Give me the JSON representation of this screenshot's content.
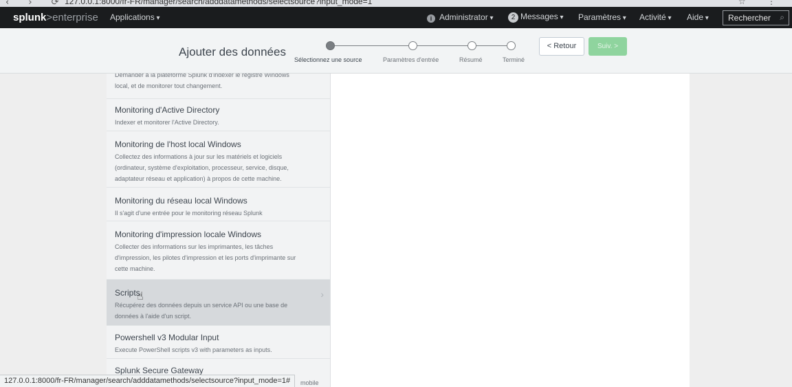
{
  "browser": {
    "nav_icons": [
      "back-icon",
      "forward-icon",
      "reload-icon"
    ],
    "url_partial": "127.0.0.1:8000/fr-FR/manager/search/adddatamethods/selectsource?input_mode=1"
  },
  "topnav": {
    "logo_brand": "splunk",
    "logo_sep": ">",
    "logo_product": "enterprise",
    "applications": "Applications",
    "admin": "Administrator",
    "messages_count": "2",
    "messages": "Messages",
    "settings": "Paramètres",
    "activity": "Activité",
    "help": "Aide",
    "search_placeholder": "Rechercher"
  },
  "wizard": {
    "title": "Ajouter des données",
    "steps": [
      {
        "label": "Sélectionnez une source",
        "active": true
      },
      {
        "label": "Paramètres d'entrée",
        "active": false
      },
      {
        "label": "Résumé",
        "active": false
      },
      {
        "label": "Terminé",
        "active": false
      }
    ],
    "back": "< Retour",
    "next": "Suiv. >"
  },
  "sources": [
    {
      "title": "",
      "desc": [
        "Demander à la plateforme Splunk d'indexer le registre Windows",
        "local, et de monitorer tout changement."
      ]
    },
    {
      "title": "Monitoring d'Active Directory",
      "desc": [
        "Indexer et monitorer l'Active Directory."
      ]
    },
    {
      "title": "Monitoring de l'host local Windows",
      "desc": [
        "Collectez des informations à jour sur les matériels et logiciels",
        "(ordinateur, système d'exploitation, processeur, service, disque,",
        "adaptateur réseau et application) à propos de cette machine."
      ]
    },
    {
      "title": "Monitoring du réseau local Windows",
      "desc": [
        "Il s'agit d'une entrée pour le monitoring réseau Splunk"
      ]
    },
    {
      "title": "Monitoring d'impression locale Windows",
      "desc": [
        "Collecter des informations sur les imprimantes, les tâches",
        "d'impression, les pilotes d'impression et les ports d'imprimante sur",
        "cette machine."
      ]
    },
    {
      "title": "Scripts",
      "desc": [
        "Récupérez des données depuis un service API ou une base de",
        "données à l'aide d'un script."
      ]
    },
    {
      "title": "Powershell v3 Modular Input",
      "desc": [
        "Execute PowerShell scripts v3 with parameters as inputs."
      ]
    },
    {
      "title": "Splunk Secure Gateway",
      "desc": [
        "mobile"
      ]
    }
  ],
  "status_url": "127.0.0.1:8000/fr-FR/manager/search/adddatamethods/selectsource?input_mode=1#"
}
